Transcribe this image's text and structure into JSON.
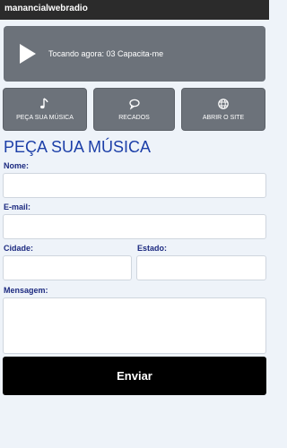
{
  "app": {
    "title": "manancialwebradio"
  },
  "player": {
    "now_playing": "Tocando agora: 03 Capacita-me",
    "play_icon": "play-icon"
  },
  "nav": [
    {
      "label": "PEÇA SUA MÚSICA",
      "icon": "music-note-icon"
    },
    {
      "label": "RECADOS",
      "icon": "speech-bubble-icon"
    },
    {
      "label": "ABRIR O SITE",
      "icon": "globe-icon"
    }
  ],
  "form": {
    "heading": "PEÇA SUA MÚSICA",
    "name_label": "Nome:",
    "email_label": "E-mail:",
    "city_label": "Cidade:",
    "state_label": "Estado:",
    "message_label": "Mensagem:",
    "submit_label": "Enviar"
  },
  "colors": {
    "accent": "#1c3fa8",
    "button": "#6c727a",
    "bar": "#2b2b2b",
    "submit": "#000000"
  }
}
